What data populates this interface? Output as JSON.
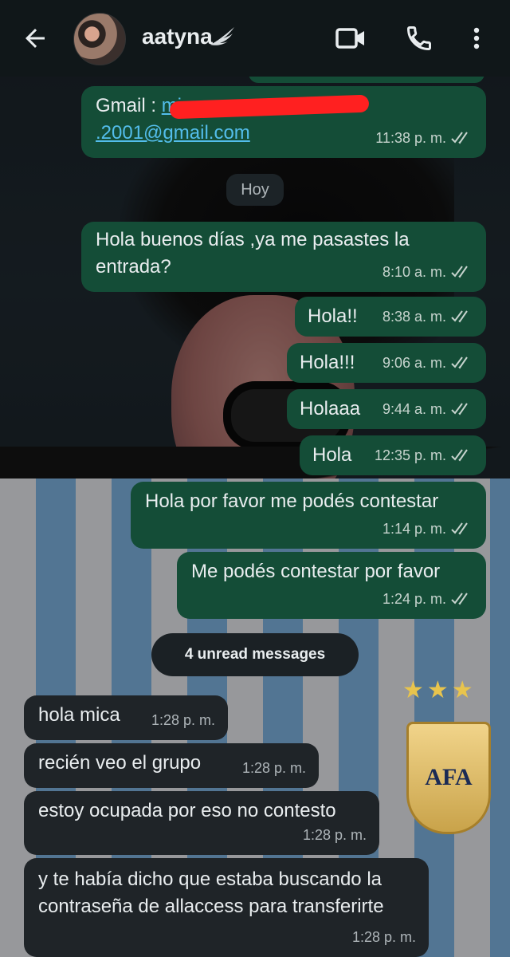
{
  "header": {
    "contact_name": "aatyna",
    "icons": [
      "back-arrow-icon",
      "wing-icon",
      "video-call-icon",
      "phone-call-icon",
      "more-vertical-icon"
    ]
  },
  "messages": [
    {
      "dir": "out",
      "prefix": "Gmail : ",
      "link_top": "mica",
      "link_bottom": ".2001@gmail.com",
      "redacted": true,
      "time": "11:38 p. m.",
      "status": "read"
    },
    {
      "dir": "out",
      "text": "Hola buenos días ,ya me pasastes la entrada?",
      "time": "8:10 a. m.",
      "status": "read"
    },
    {
      "dir": "out",
      "text": "Hola!!",
      "time": "8:38 a. m.",
      "status": "read"
    },
    {
      "dir": "out",
      "text": "Hola!!!",
      "time": "9:06 a. m.",
      "status": "read"
    },
    {
      "dir": "out",
      "text": "Holaaa",
      "time": "9:44 a. m.",
      "status": "read"
    },
    {
      "dir": "out",
      "text": "Hola",
      "time": "12:35 p. m.",
      "status": "read"
    },
    {
      "dir": "out",
      "text": "Hola por favor me podés contestar",
      "time": "1:14 p. m.",
      "status": "read"
    },
    {
      "dir": "out",
      "text": "Me podés contestar por favor",
      "time": "1:24 p. m.",
      "status": "read"
    },
    {
      "dir": "in",
      "text": "hola mica",
      "time": "1:28 p. m."
    },
    {
      "dir": "in",
      "text": "recién veo el grupo",
      "time": "1:28 p. m."
    },
    {
      "dir": "in",
      "text": "estoy ocupada por eso no contesto",
      "time": "1:28 p. m."
    },
    {
      "dir": "in",
      "text": "y te había dicho que estaba buscando la contraseña de allaccess para transferirte",
      "time": "1:28 p. m."
    }
  ],
  "date_divider": "Hoy",
  "unread_divider": "4 unread messages",
  "wallpaper": {
    "badge_text": "AFA"
  },
  "colors": {
    "outgoing_bubble": "#144d37",
    "incoming_bubble": "#1f2428",
    "header": "#101719",
    "link": "#53bdeb",
    "read_ticks": "#c7d4ce"
  }
}
